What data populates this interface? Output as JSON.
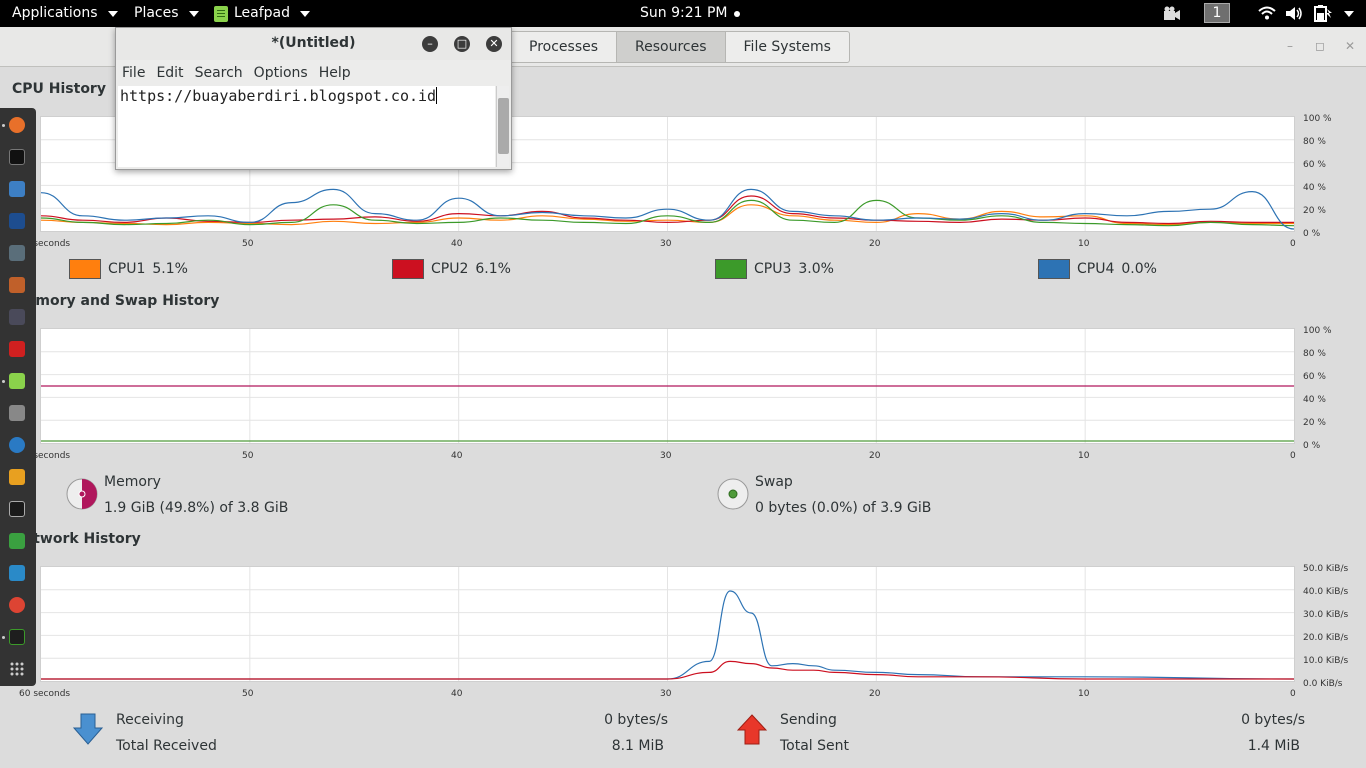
{
  "topbar": {
    "applications": "Applications",
    "places": "Places",
    "leafpad": "Leafpad",
    "clock": "Sun  9:21 PM",
    "workspace": "1"
  },
  "tabs": [
    "Processes",
    "Resources",
    "File Systems"
  ],
  "leafpad": {
    "title": "*(Untitled)",
    "menu": [
      "File",
      "Edit",
      "Search",
      "Options",
      "Help"
    ],
    "text": "https://buayaberdiri.blogspot.co.id"
  },
  "cpu": {
    "title": "CPU History",
    "legend": [
      {
        "label": "CPU1",
        "value": "5.1%",
        "color": "#ff7f0e"
      },
      {
        "label": "CPU2",
        "value": "6.1%",
        "color": "#cc1020"
      },
      {
        "label": "CPU3",
        "value": "3.0%",
        "color": "#3c9a2a"
      },
      {
        "label": "CPU4",
        "value": "0.0%",
        "color": "#2d73b4"
      }
    ]
  },
  "memory": {
    "title": "Memory and Swap History",
    "memory_label": "Memory",
    "memory_value": "1.9 GiB (49.8%) of 3.8 GiB",
    "swap_label": "Swap",
    "swap_value": "0 bytes (0.0%) of 3.9 GiB",
    "memory_color": "#b0175c",
    "swap_color": "#4f9a3a"
  },
  "network": {
    "title": "Network History",
    "receiving_label": "Receiving",
    "receiving_value": "0 bytes/s",
    "total_received_label": "Total Received",
    "total_received_value": "8.1 MiB",
    "sending_label": "Sending",
    "sending_value": "0 bytes/s",
    "total_sent_label": "Total Sent",
    "total_sent_value": "1.4 MiB"
  },
  "axes": {
    "x_ticks": [
      "60 seconds",
      "50",
      "40",
      "30",
      "20",
      "10",
      "0"
    ],
    "pct_ticks": [
      "100 %",
      "80 %",
      "60 %",
      "40 %",
      "20 %",
      "0 %"
    ],
    "net_ticks": [
      "50.0 KiB/s",
      "40.0 KiB/s",
      "30.0 KiB/s",
      "20.0 KiB/s",
      "10.0 KiB/s",
      "0.0 KiB/s"
    ]
  },
  "chart_data": [
    {
      "type": "line",
      "title": "CPU History",
      "x": [
        60,
        58,
        56,
        54,
        52,
        50,
        48,
        46,
        44,
        42,
        40,
        38,
        36,
        34,
        32,
        30,
        28,
        26,
        24,
        22,
        20,
        18,
        16,
        14,
        12,
        10,
        8,
        6,
        4,
        2,
        0
      ],
      "xlabel": "seconds",
      "ylim": [
        0,
        100
      ],
      "series": [
        {
          "name": "CPU1",
          "values": [
            8,
            6,
            5,
            4,
            6,
            5,
            4,
            7,
            5,
            6,
            10,
            8,
            12,
            9,
            7,
            8,
            6,
            22,
            12,
            8,
            6,
            14,
            9,
            16,
            11,
            12,
            5,
            4,
            6,
            5,
            5
          ]
        },
        {
          "name": "CPU2",
          "values": [
            12,
            8,
            6,
            10,
            7,
            6,
            8,
            9,
            11,
            7,
            14,
            12,
            16,
            10,
            8,
            6,
            8,
            30,
            14,
            10,
            8,
            7,
            6,
            9,
            8,
            10,
            6,
            5,
            7,
            6,
            6
          ]
        },
        {
          "name": "CPU3",
          "values": [
            10,
            6,
            4,
            5,
            8,
            4,
            6,
            22,
            8,
            5,
            6,
            10,
            8,
            6,
            5,
            12,
            6,
            26,
            8,
            6,
            26,
            10,
            8,
            12,
            6,
            5,
            4,
            3,
            6,
            4,
            3
          ]
        },
        {
          "name": "CPU4",
          "values": [
            33,
            12,
            8,
            10,
            12,
            6,
            24,
            36,
            14,
            8,
            28,
            12,
            15,
            12,
            10,
            18,
            8,
            36,
            16,
            12,
            8,
            10,
            9,
            14,
            8,
            14,
            12,
            16,
            18,
            34,
            0
          ]
        }
      ]
    },
    {
      "type": "line",
      "title": "Memory and Swap History",
      "x": [
        60,
        50,
        40,
        30,
        20,
        10,
        0
      ],
      "xlabel": "seconds",
      "ylim": [
        0,
        100
      ],
      "series": [
        {
          "name": "Memory",
          "values": [
            50,
            50,
            50,
            50,
            50,
            50,
            50
          ]
        },
        {
          "name": "Swap",
          "values": [
            0,
            0,
            0,
            0,
            0,
            0,
            0
          ]
        }
      ]
    },
    {
      "type": "line",
      "title": "Network History",
      "x": [
        60,
        35,
        30,
        28,
        27,
        26,
        25,
        24,
        23,
        22,
        20,
        18,
        15,
        10,
        0
      ],
      "xlabel": "seconds",
      "ylim": [
        0,
        50
      ],
      "series": [
        {
          "name": "Receiving",
          "values": [
            0,
            0,
            0,
            8,
            40,
            30,
            6,
            7,
            6,
            4,
            3,
            2,
            1,
            1,
            0
          ]
        },
        {
          "name": "Sending",
          "values": [
            0,
            0,
            0,
            3,
            8,
            7,
            5,
            4,
            4,
            3,
            2,
            1,
            1,
            0,
            0
          ]
        }
      ]
    }
  ]
}
